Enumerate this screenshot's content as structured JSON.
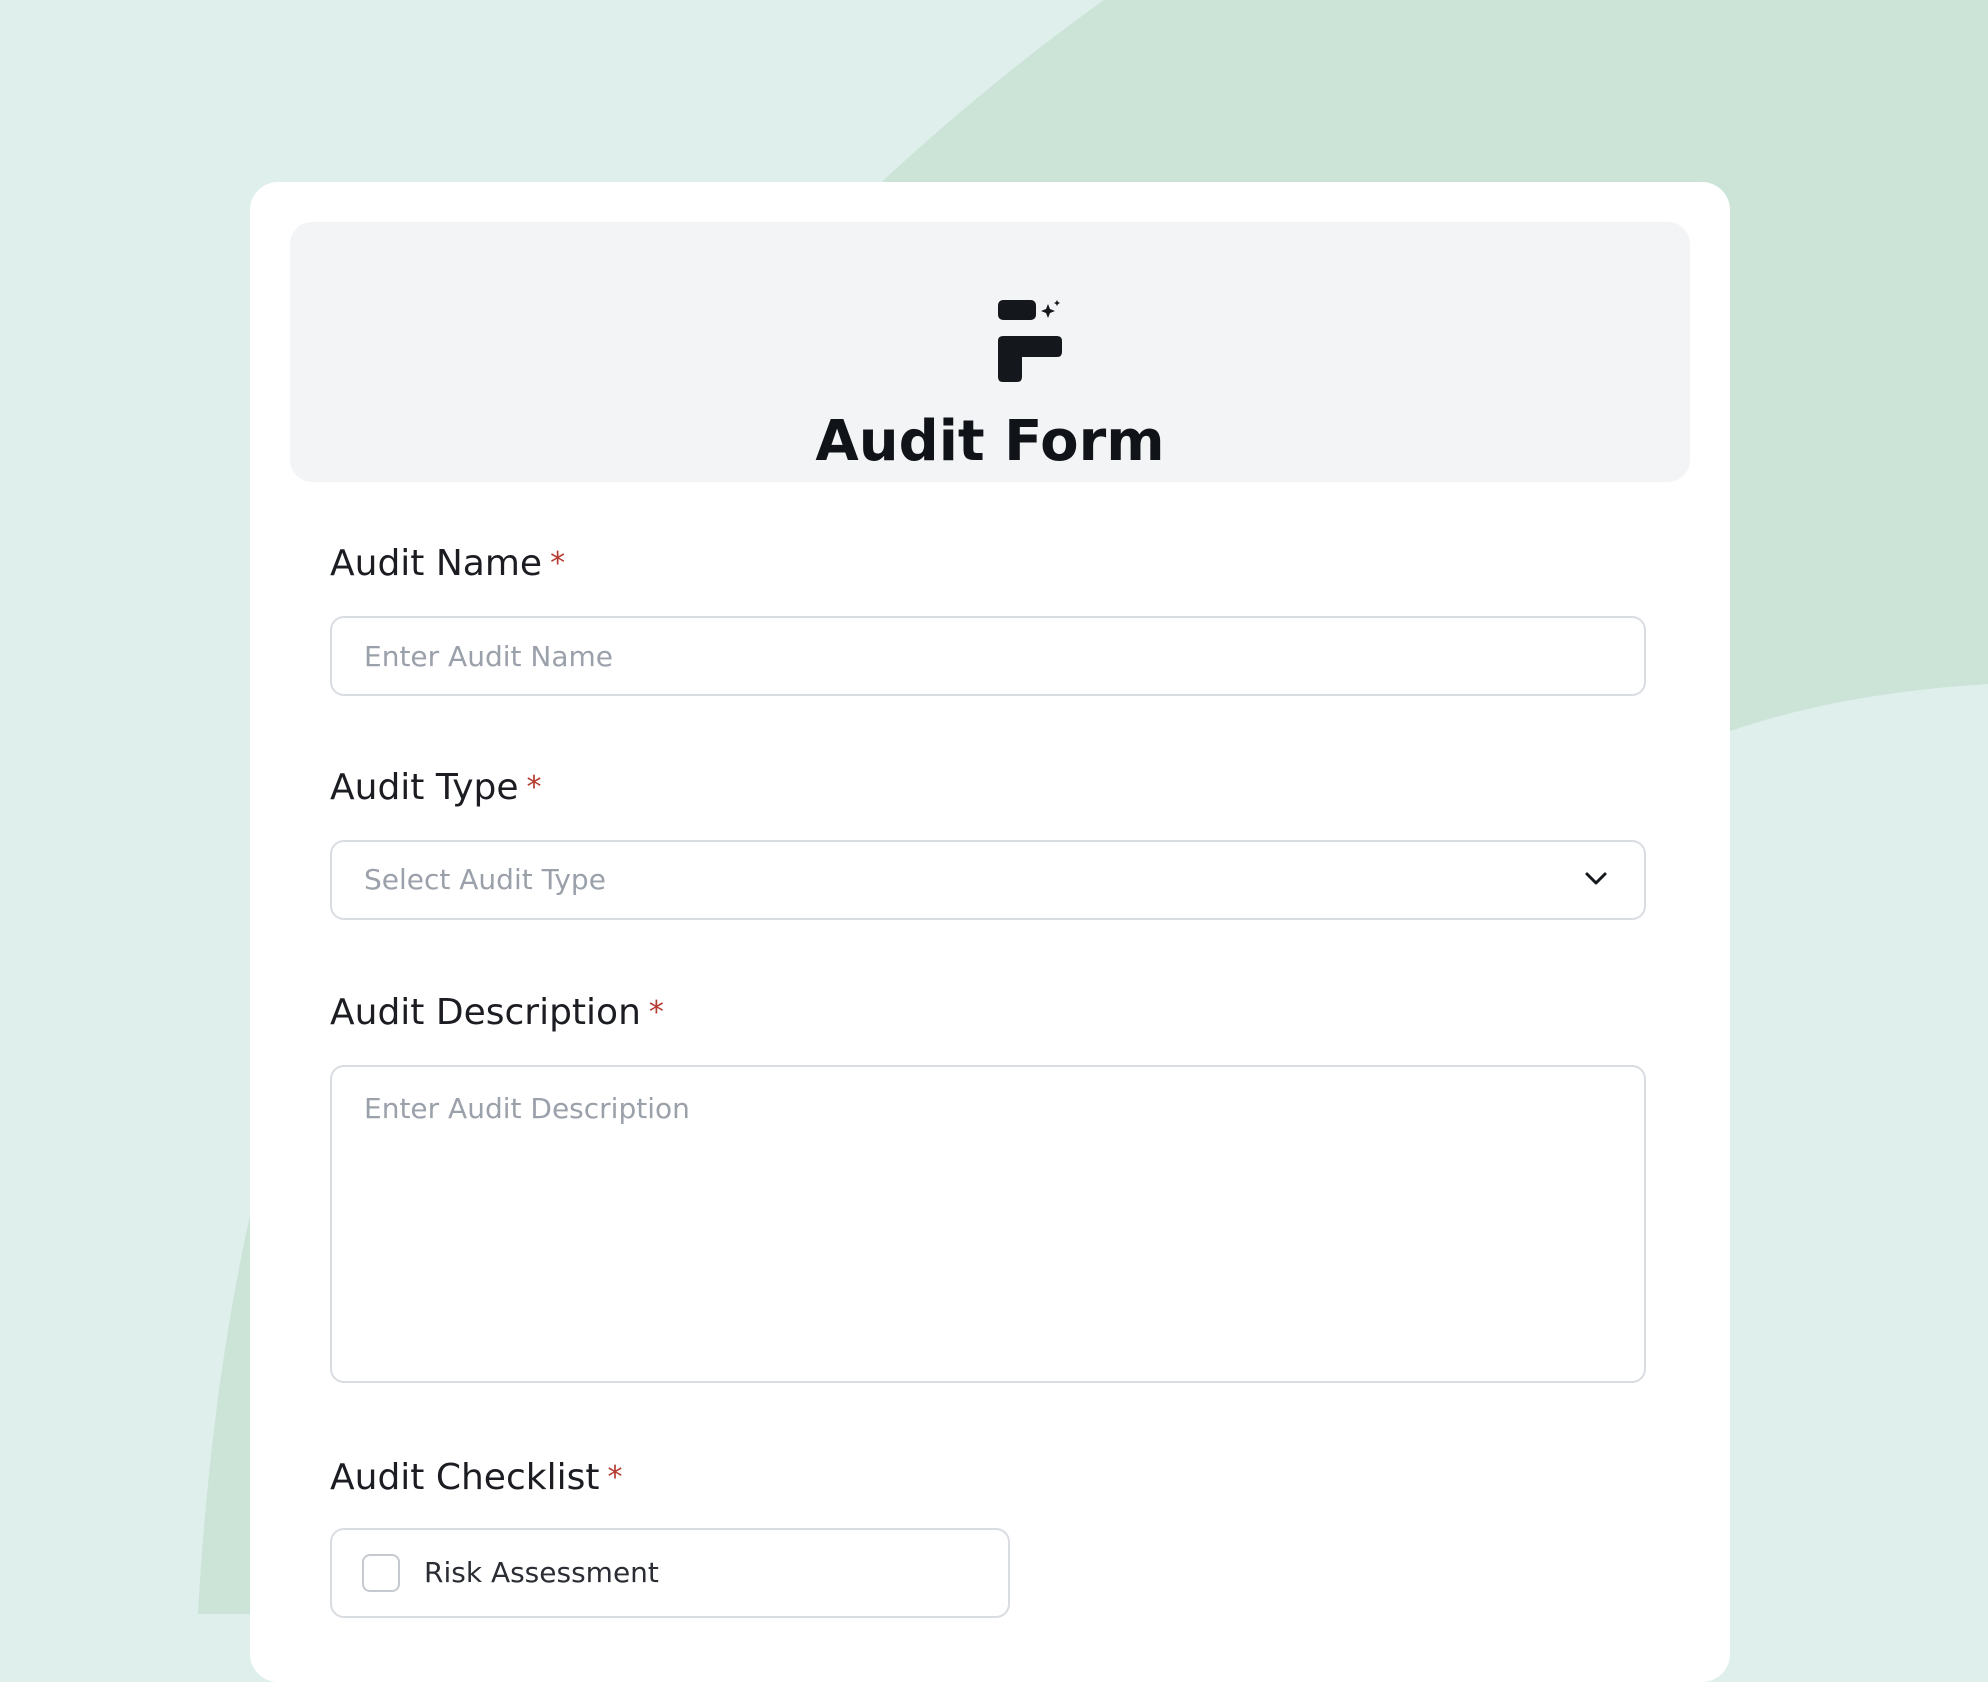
{
  "colors": {
    "page_background": "#dfefec",
    "background_shape": "#cce4d8",
    "card": "#ffffff",
    "header_background": "#f3f4f6",
    "required_asterisk": "#b53a2f",
    "input_border": "#d9dce1",
    "placeholder": "#9ba1aa"
  },
  "header": {
    "logo_icon": "form-logo-icon",
    "title": "Audit Form"
  },
  "form": {
    "audit_name": {
      "label": "Audit Name",
      "required_mark": "*",
      "placeholder": "Enter Audit Name"
    },
    "audit_type": {
      "label": "Audit Type",
      "required_mark": "*",
      "placeholder": "Select Audit Type",
      "icon": "chevron-down-icon"
    },
    "audit_description": {
      "label": "Audit Description",
      "required_mark": "*",
      "placeholder": "Enter Audit Description"
    },
    "audit_checklist": {
      "label": "Audit Checklist",
      "required_mark": "*",
      "items": [
        {
          "label": "Risk Assessment",
          "checked": false
        }
      ]
    }
  }
}
